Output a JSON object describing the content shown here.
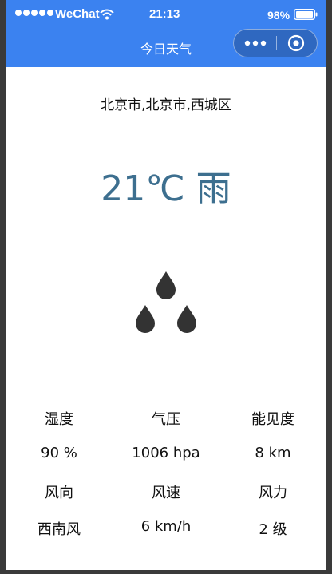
{
  "status_bar": {
    "carrier": "WeChat",
    "time": "21:13",
    "battery": "98%"
  },
  "nav": {
    "title": "今日天气"
  },
  "weather": {
    "location": "北京市,北京市,西城区",
    "temperature": "21℃ 雨",
    "icon": "rain-drops-icon"
  },
  "details": {
    "humidity_label": "湿度",
    "humidity_value": "90 %",
    "pressure_label": "气压",
    "pressure_value": "1006 hpa",
    "visibility_label": "能见度",
    "visibility_value": "8 km",
    "wind_direction_label": "风向",
    "wind_direction_value": "西南风",
    "wind_speed_label": "风速",
    "wind_speed_value": "6 km/h",
    "wind_force_label": "风力",
    "wind_force_value": "2 级"
  },
  "colors": {
    "nav_bar": "#3b82f0",
    "temperature_text": "#3d6f8f",
    "icon": "#333333"
  }
}
